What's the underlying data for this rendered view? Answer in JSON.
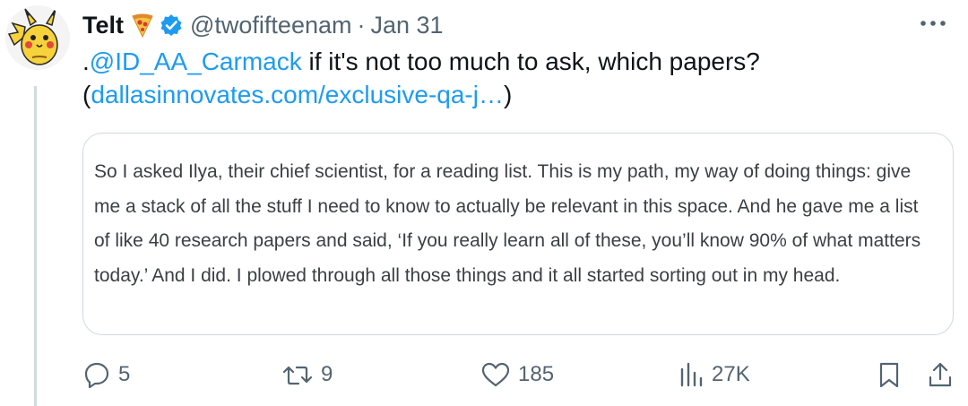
{
  "author": {
    "display_name": "Telt",
    "emoji": "pizza",
    "verified_icon": "verified-badge-icon",
    "handle": "@twofifteenam",
    "separator": "·",
    "date": "Jan 31"
  },
  "tweet": {
    "prefix": ".",
    "mention": "@ID_AA_Carmack",
    "text": " if it's not too much to ask, which papers?",
    "link_open": "(",
    "link": "dallasinnovates.com/exclusive-qa-j…",
    "link_close": ")"
  },
  "quote": {
    "text": "So I asked Ilya, their chief scientist, for a reading list. This is my path, my way of doing things: give me a stack of all the stuff I need to know to actually be relevant in this space. And he gave me a list of like 40 research papers and said, ‘If you really learn all of these, you’ll know 90% of what matters today.’ And I did. I plowed through all those things and it all started sorting out in my head."
  },
  "actions": {
    "replies": "5",
    "retweets": "9",
    "likes": "185",
    "views": "27K"
  },
  "colors": {
    "link": "#1d9bf0",
    "muted": "#536471",
    "border": "#cfd9de",
    "text": "#0f1419"
  }
}
